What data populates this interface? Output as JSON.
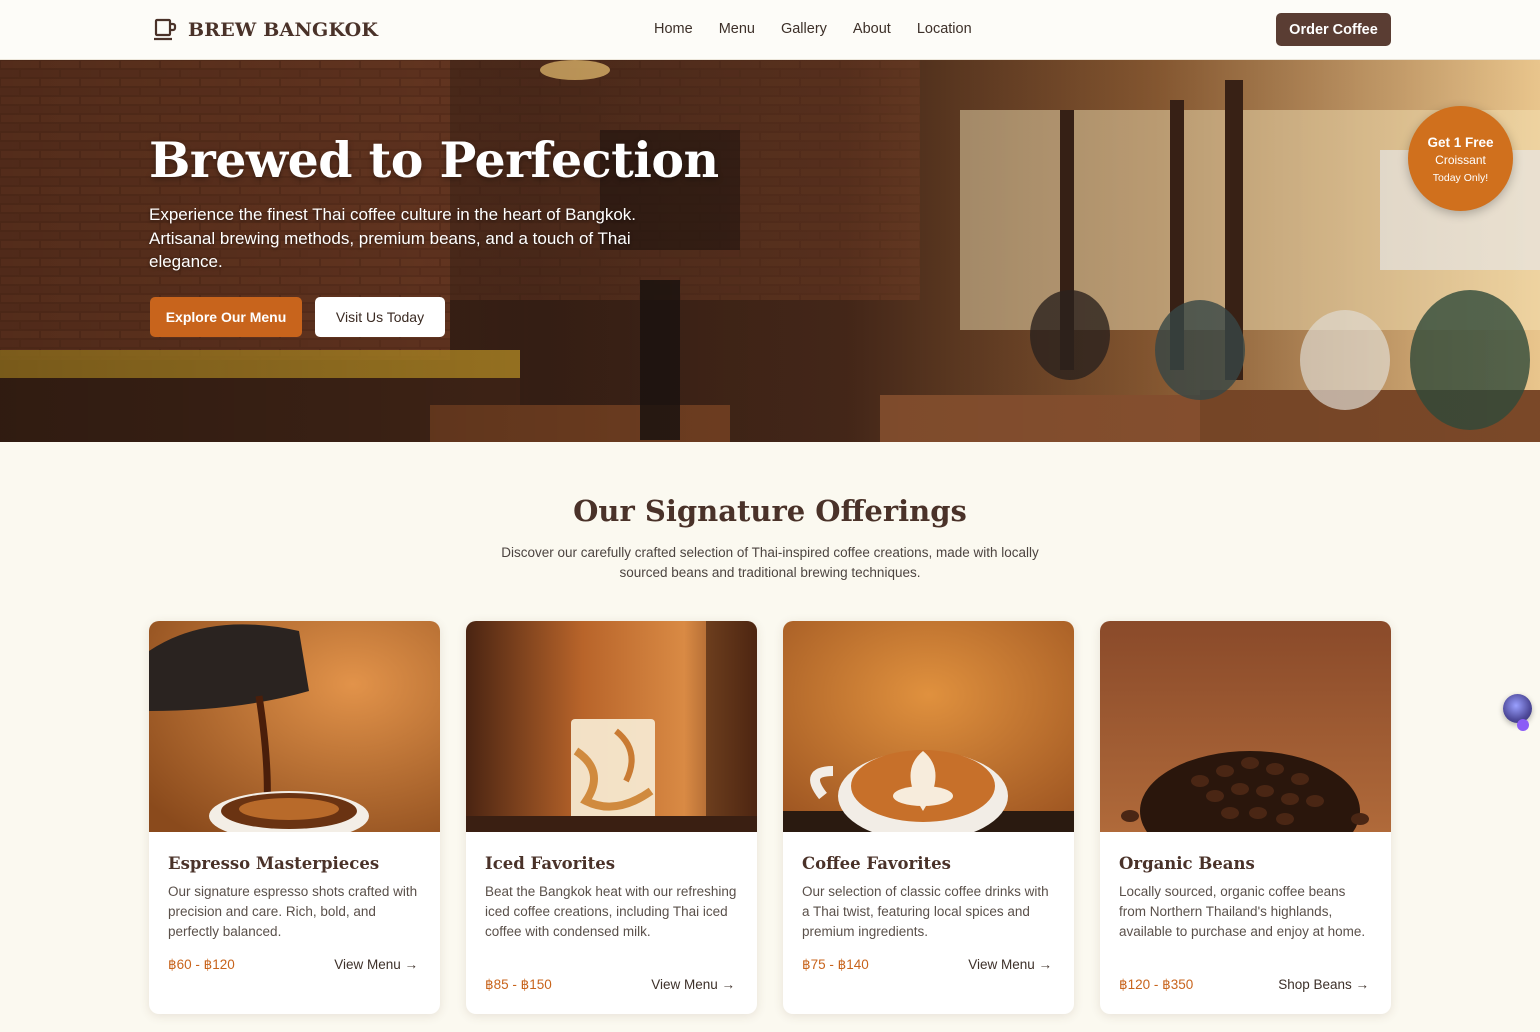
{
  "nav": {
    "brand": "BREW BANGKOK",
    "logo_icon": "coffee-cup-icon",
    "links": [
      "Home",
      "Menu",
      "Gallery",
      "About",
      "Location"
    ],
    "order_label": "Order Coffee"
  },
  "hero": {
    "title": "Brewed to Perfection",
    "subtitle": "Experience the finest Thai coffee culture in the heart of Bangkok. Artisanal brewing methods, premium beans, and a touch of Thai elegance.",
    "primary_cta": "Explore Our Menu",
    "secondary_cta": "Visit Us Today",
    "promo": {
      "line1": "Get 1 Free",
      "line2": "Croissant",
      "line3": "Today Only!"
    }
  },
  "offerings": {
    "title": "Our Signature Offerings",
    "subtitle": "Discover our carefully crafted selection of Thai-inspired coffee creations, made with locally sourced beans and traditional brewing techniques.",
    "cards": [
      {
        "title": "Espresso Masterpieces",
        "description": "Our signature espresso shots crafted with precision and care. Rich, bold, and perfectly balanced.",
        "price": "฿60 - ฿120",
        "link": "View Menu →"
      },
      {
        "title": "Iced Favorites",
        "description": "Beat the Bangkok heat with our refreshing iced coffee creations, including Thai iced coffee with condensed milk.",
        "price": "฿85 - ฿150",
        "link": "View Menu →"
      },
      {
        "title": "Coffee Favorites",
        "description": "Our selection of classic coffee drinks with a Thai twist, featuring local spices and premium ingredients.",
        "price": "฿75 - ฿140",
        "link": "View Menu →"
      },
      {
        "title": "Organic Beans",
        "description": "Locally sourced, organic coffee beans from Northern Thailand's highlands, available to purchase and enjoy at home.",
        "price": "฿120 - ฿350",
        "link": "Shop Beans →"
      }
    ]
  },
  "colors": {
    "accent": "#c8641c",
    "brand_dark": "#5a3d33",
    "background": "#fbf9f0"
  }
}
